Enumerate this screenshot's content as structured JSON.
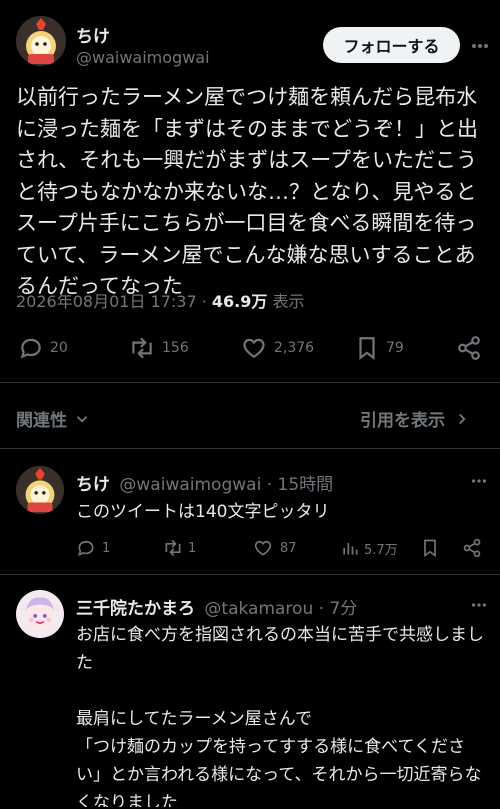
{
  "main_tweet": {
    "author_name": "ちけ",
    "author_handle": "@waiwaimogwai",
    "follow_label": "フォローする",
    "text": "以前行ったラーメン屋でつけ麺を頼んだら昆布水に浸った麺を「まずはそのままでどうぞ！」と出され、それも一興だがまずはスープをいただこうと待つもなかなか来ないな…？となり、見やるとスープ片手にこちらが一口目を食べる瞬間を待っていて、ラーメン屋でこんな嫌な思いすることあるんだってなった",
    "timestamp": "2026年08月01日 17:37",
    "view_count": "46.9万",
    "view_label": "表示",
    "stats": {
      "replies": "20",
      "retweets": "156",
      "likes": "2,376",
      "bookmarks": "79"
    }
  },
  "sort_bar": {
    "relevance_label": "関連性",
    "quotes_label": "引用を表示"
  },
  "replies": [
    {
      "author_name": "ちけ",
      "author_handle": "@waiwaimogwai",
      "time": "15時間",
      "text": "このツイートは140文字ピッタリ",
      "stats": {
        "replies": "1",
        "retweets": "1",
        "likes": "87",
        "views": "5.7万"
      }
    },
    {
      "author_name": "三千院たかまろ",
      "author_handle": "@takamarou",
      "time": "7分",
      "text": "お店に食べ方を指図されるの本当に苦手で共感しました\n\n最肩にしてたラーメン屋さんで\n「つけ麺のカップを持ってすする様に食べてください」とか言われる様になって、それから一切近寄らなくなりました"
    }
  ],
  "icons": {
    "reply": "reply-icon",
    "retweet": "retweet-icon",
    "like": "heart-icon",
    "bookmark": "bookmark-icon",
    "share": "share-icon",
    "views": "views-icon",
    "more": "more-icon",
    "chevron": "chevron-down-icon",
    "chevron_right": "chevron-right-icon"
  }
}
